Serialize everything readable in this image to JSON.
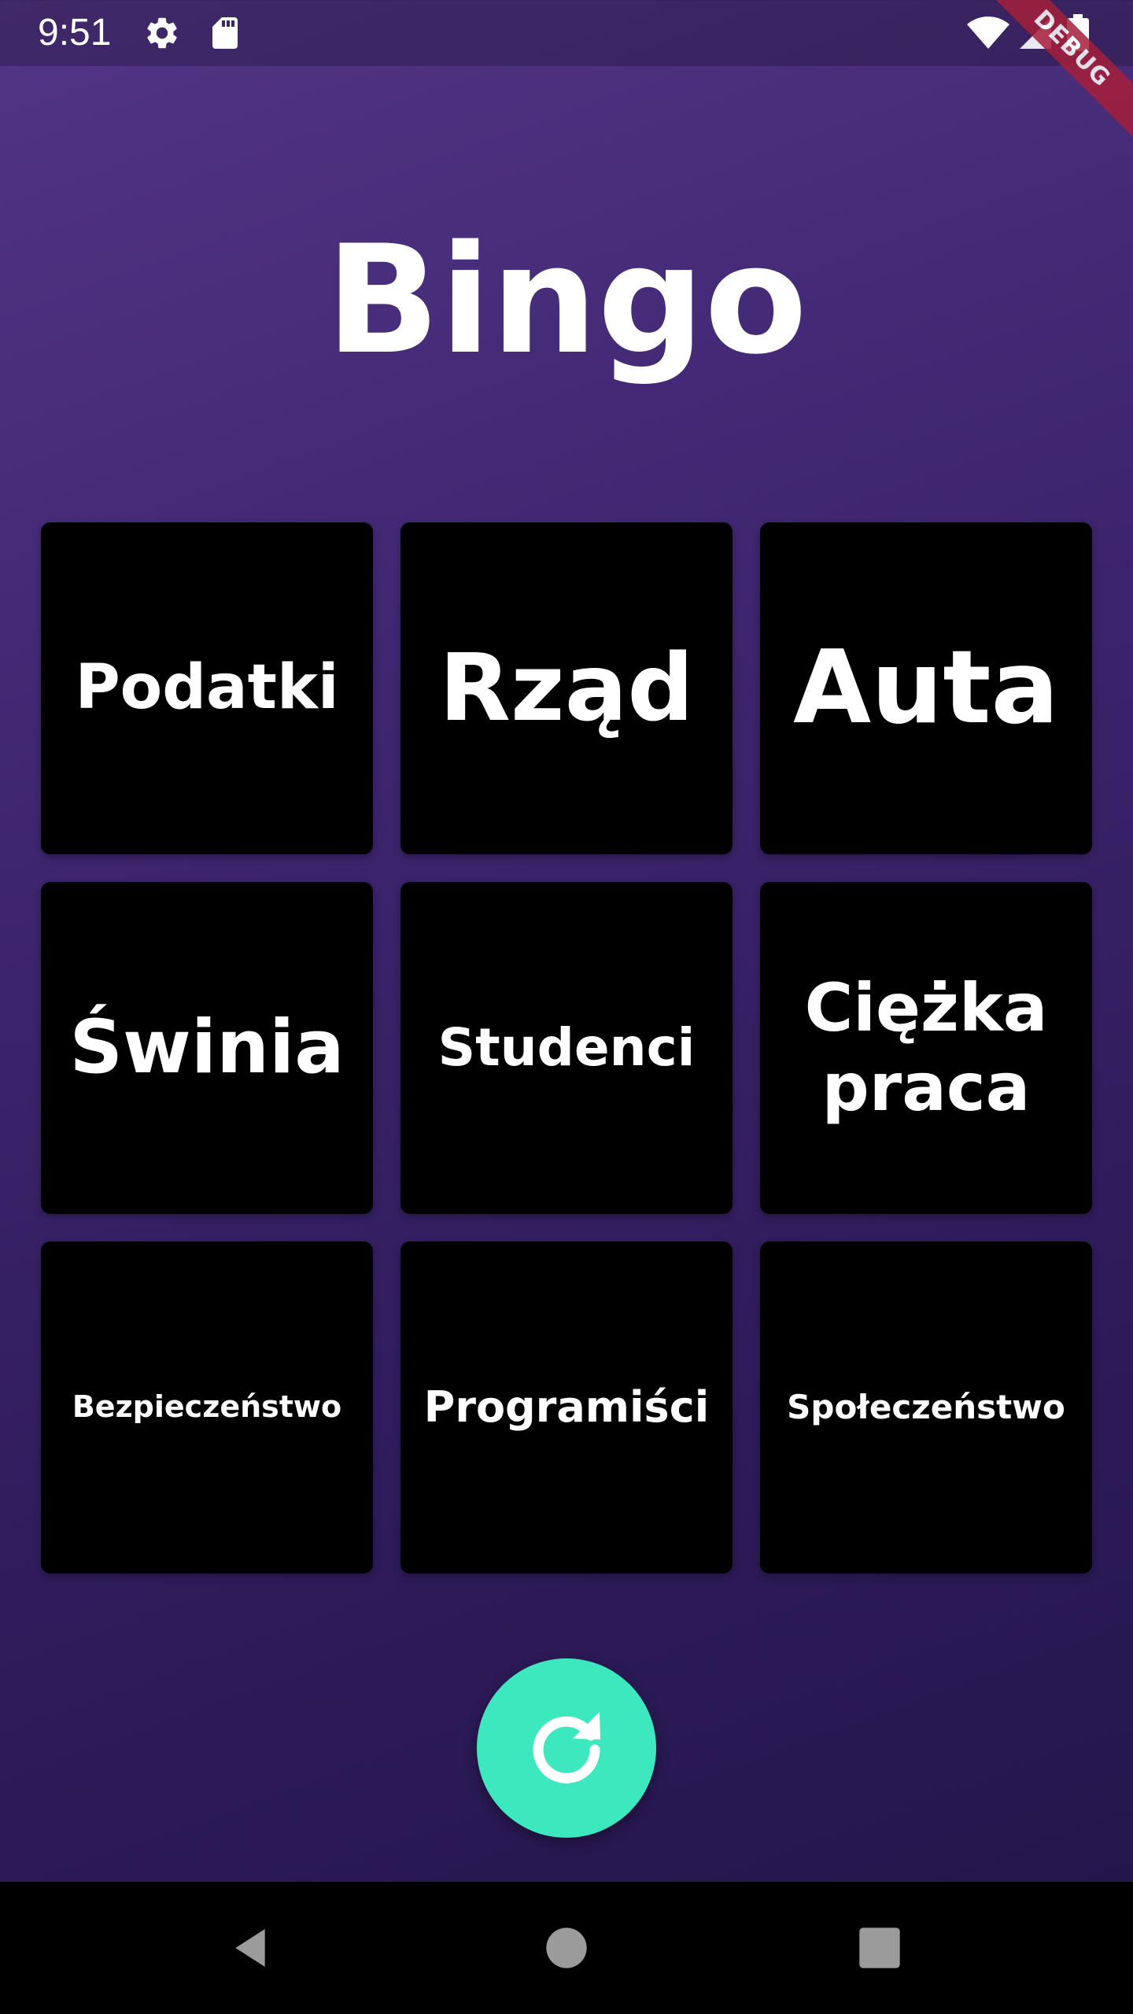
{
  "status_bar": {
    "time": "9:51",
    "icons": [
      "settings-icon",
      "sd-card-icon",
      "wifi-icon",
      "signal-icon",
      "battery-icon"
    ]
  },
  "debug_banner": "DEBUG",
  "title": "Bingo",
  "tiles": [
    {
      "label": "Podatki"
    },
    {
      "label": "Rząd"
    },
    {
      "label": "Auta"
    },
    {
      "label": "Świnia"
    },
    {
      "label": "Studenci"
    },
    {
      "label": "Ciężka praca"
    },
    {
      "label": "Bezpieczeństwo"
    },
    {
      "label": "Programiści"
    },
    {
      "label": "Społeczeństwo"
    }
  ],
  "fab": {
    "icon": "refresh-icon"
  },
  "navigation": {
    "icons": [
      "back-icon",
      "home-icon",
      "recents-icon"
    ]
  },
  "colors": {
    "background_top": "#523586",
    "background_bottom": "#22154a",
    "tile": "#000000",
    "accent": "#3de8bf",
    "debug_banner": "#a51f3a"
  }
}
